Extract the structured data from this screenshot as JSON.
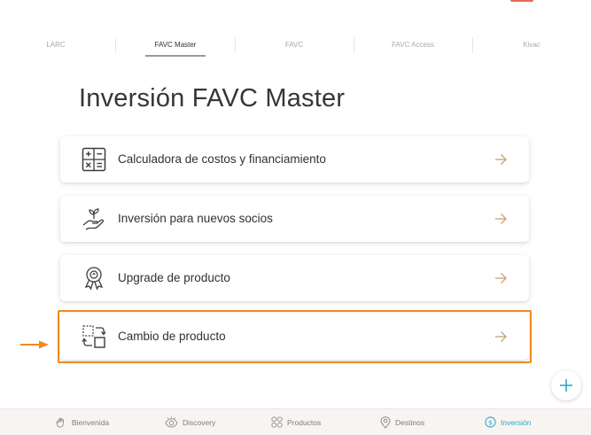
{
  "tabs": [
    {
      "label": "LARC",
      "active": false
    },
    {
      "label": "FAVC Master",
      "active": true
    },
    {
      "label": "FAVC",
      "active": false
    },
    {
      "label": "FAVC Access",
      "active": false
    },
    {
      "label": "Kivac",
      "active": false
    }
  ],
  "page_title": "Inversión FAVC Master",
  "cards": [
    {
      "label": "Calculadora de costos y financiamiento",
      "icon": "calculator-icon"
    },
    {
      "label": "Inversión para nuevos socios",
      "icon": "hand-plant-icon"
    },
    {
      "label": "Upgrade de producto",
      "icon": "award-badge-icon"
    },
    {
      "label": "Cambio de producto",
      "icon": "swap-boxes-icon",
      "highlighted": true
    }
  ],
  "bottom_nav": [
    {
      "label": "Bienvenida",
      "icon": "hand-icon",
      "active": false
    },
    {
      "label": "Discovery",
      "icon": "eye-icon",
      "active": false
    },
    {
      "label": "Productos",
      "icon": "grid-icon",
      "active": false
    },
    {
      "label": "Destinos",
      "icon": "map-pin-icon",
      "active": false
    },
    {
      "label": "Inversión",
      "icon": "dollar-circle-icon",
      "active": true
    }
  ],
  "colors": {
    "accent": "#2aa9c6",
    "highlight": "#f08a1c",
    "arrow": "#c9a27a",
    "title": "#34363b"
  }
}
